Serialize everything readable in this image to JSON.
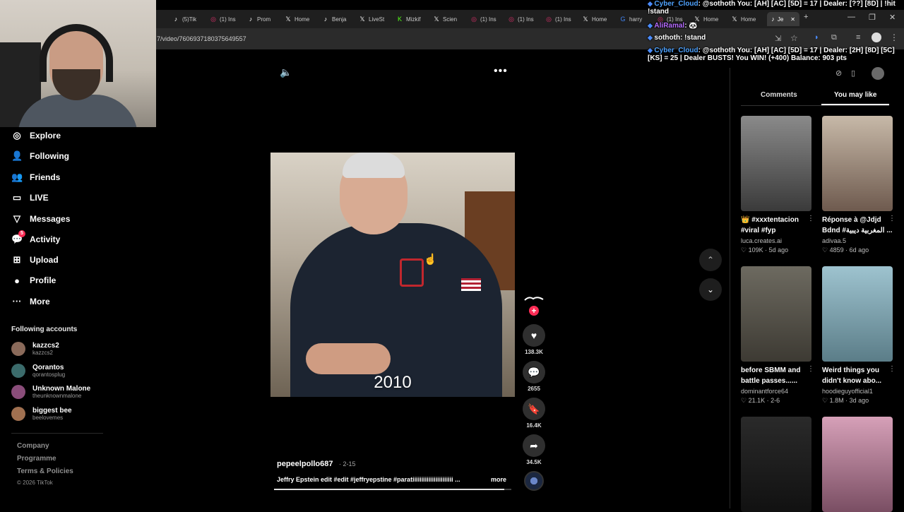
{
  "browser": {
    "tabs": [
      {
        "icon": "tiktok-icon",
        "label": "(5)Tik"
      },
      {
        "icon": "instagram-icon",
        "label": "(1) Ins"
      },
      {
        "icon": "tiktok-icon",
        "label": "Prom"
      },
      {
        "icon": "x-icon",
        "label": "Home"
      },
      {
        "icon": "tiktok-icon",
        "label": "Benja"
      },
      {
        "icon": "x-icon",
        "label": "LiveSt"
      },
      {
        "icon": "kick-icon",
        "label": "Mizkif"
      },
      {
        "icon": "x-icon",
        "label": "Scien"
      },
      {
        "icon": "instagram-icon",
        "label": "(1) Ins"
      },
      {
        "icon": "instagram-icon",
        "label": "(1) Ins"
      },
      {
        "icon": "instagram-icon",
        "label": "(1) Ins"
      },
      {
        "icon": "x-icon",
        "label": "Home"
      },
      {
        "icon": "google-icon",
        "label": "harry"
      },
      {
        "icon": "instagram-icon",
        "label": "(1) Ins"
      },
      {
        "icon": "x-icon",
        "label": "Home"
      },
      {
        "icon": "x-icon",
        "label": "Home"
      },
      {
        "icon": "tiktok-icon",
        "label": "Je"
      }
    ],
    "url": "7/video/7606937180375649557"
  },
  "chat": [
    {
      "name": "Cyber_Cloud",
      "text": ": @sothoth You: [AH] [AC] [5D] = 17 | Dealer: [??] [8D] | !hit !stand",
      "color": "#4fa3ff"
    },
    {
      "name": "AliRamal",
      "text": ": 🐼",
      "color": "#b66bff"
    },
    {
      "name": "sothoth",
      "text": ": !stand",
      "color": "#ffffff"
    },
    {
      "name": "Cyber_Cloud",
      "text": ": @sothoth You: [AH] [AC] [5D] = 17 | Dealer: [2H] [8D] [5C] [KS] = 25 | Dealer BUSTS! You WIN! (+400) Balance: 903 pts",
      "color": "#4fa3ff"
    }
  ],
  "sidebar": {
    "nav": [
      {
        "icon": "compass-icon",
        "label": "Explore"
      },
      {
        "icon": "following-icon",
        "label": "Following"
      },
      {
        "icon": "friends-icon",
        "label": "Friends"
      },
      {
        "icon": "live-icon",
        "label": "LIVE"
      },
      {
        "icon": "messages-icon",
        "label": "Messages"
      },
      {
        "icon": "activity-icon",
        "label": "Activity",
        "badge": "5"
      },
      {
        "icon": "upload-icon",
        "label": "Upload"
      },
      {
        "icon": "profile-avatar",
        "label": "Profile"
      },
      {
        "icon": "more-icon",
        "label": "More"
      }
    ],
    "following_title": "Following accounts",
    "accounts": [
      {
        "name": "kazzcs2",
        "handle": "kazzcs2",
        "color": "#8a6a5a"
      },
      {
        "name": "Qorantos",
        "handle": "qorantosplug",
        "color": "#3b6b6b"
      },
      {
        "name": "Unknown Malone",
        "handle": "theunknownmalone",
        "color": "#8a4d7a"
      },
      {
        "name": "biggest bee",
        "handle": "beelovemes",
        "color": "#a07050"
      }
    ],
    "footer": [
      "Company",
      "Programme",
      "Terms & Policies"
    ],
    "copyright": "© 2026 TikTok"
  },
  "video": {
    "year_overlay": "2010",
    "author": "pepeelpollo687",
    "date": "· 2-15",
    "caption": "Jeffry Epstein edit #edit #jeffryepstine #paratiiiiiiiiiiiiiiiiiiiiiii ...",
    "more_label": "more",
    "progress": 0.97,
    "actions": [
      {
        "name": "like",
        "icon": "heart-icon",
        "glyph": "♥",
        "count": "138.3K"
      },
      {
        "name": "comment",
        "icon": "comment-icon",
        "glyph": "💬",
        "count": "2655"
      },
      {
        "name": "save",
        "icon": "bookmark-icon",
        "glyph": "🔖",
        "count": "16.4K"
      },
      {
        "name": "share",
        "icon": "share-icon",
        "glyph": "➦",
        "count": "34.5K"
      }
    ]
  },
  "right_panel": {
    "tabs": [
      {
        "label": "Comments",
        "active": false
      },
      {
        "label": "You may like",
        "active": true
      }
    ],
    "cards": [
      {
        "title": "👑 #xxxtentacion #viral #fyp",
        "author": "luca.creates.ai",
        "likes": "109K",
        "age": "5d ago",
        "bg": "linear-gradient(180deg,#8a8a8a,#3a3a3a)"
      },
      {
        "title": "Réponse à @Jdjd Bdnd #المغربية ديبية ...",
        "author": "adivaa.5",
        "likes": "4859",
        "age": "6d ago",
        "bg": "linear-gradient(180deg,#c7b9a8,#6e5a4e)"
      },
      {
        "title": "before SBMM and battle passes......",
        "author": "dominantforce64",
        "likes": "21.1K",
        "age": "2-6",
        "bg": "linear-gradient(180deg,#6d6a60,#3d3a33)"
      },
      {
        "title": "Weird things you didn't know abo...",
        "author": "hoodieguyofficial1",
        "likes": "1.8M",
        "age": "3d ago",
        "bg": "linear-gradient(180deg,#9ec3cf,#5b7d88)"
      },
      {
        "title": "",
        "author": "",
        "likes": "",
        "age": "",
        "bg": "linear-gradient(180deg,#2a2a2a,#111)"
      },
      {
        "title": "",
        "author": "",
        "likes": "",
        "age": "",
        "bg": "linear-gradient(180deg,#d6a0b8,#7a4e63)"
      }
    ]
  }
}
